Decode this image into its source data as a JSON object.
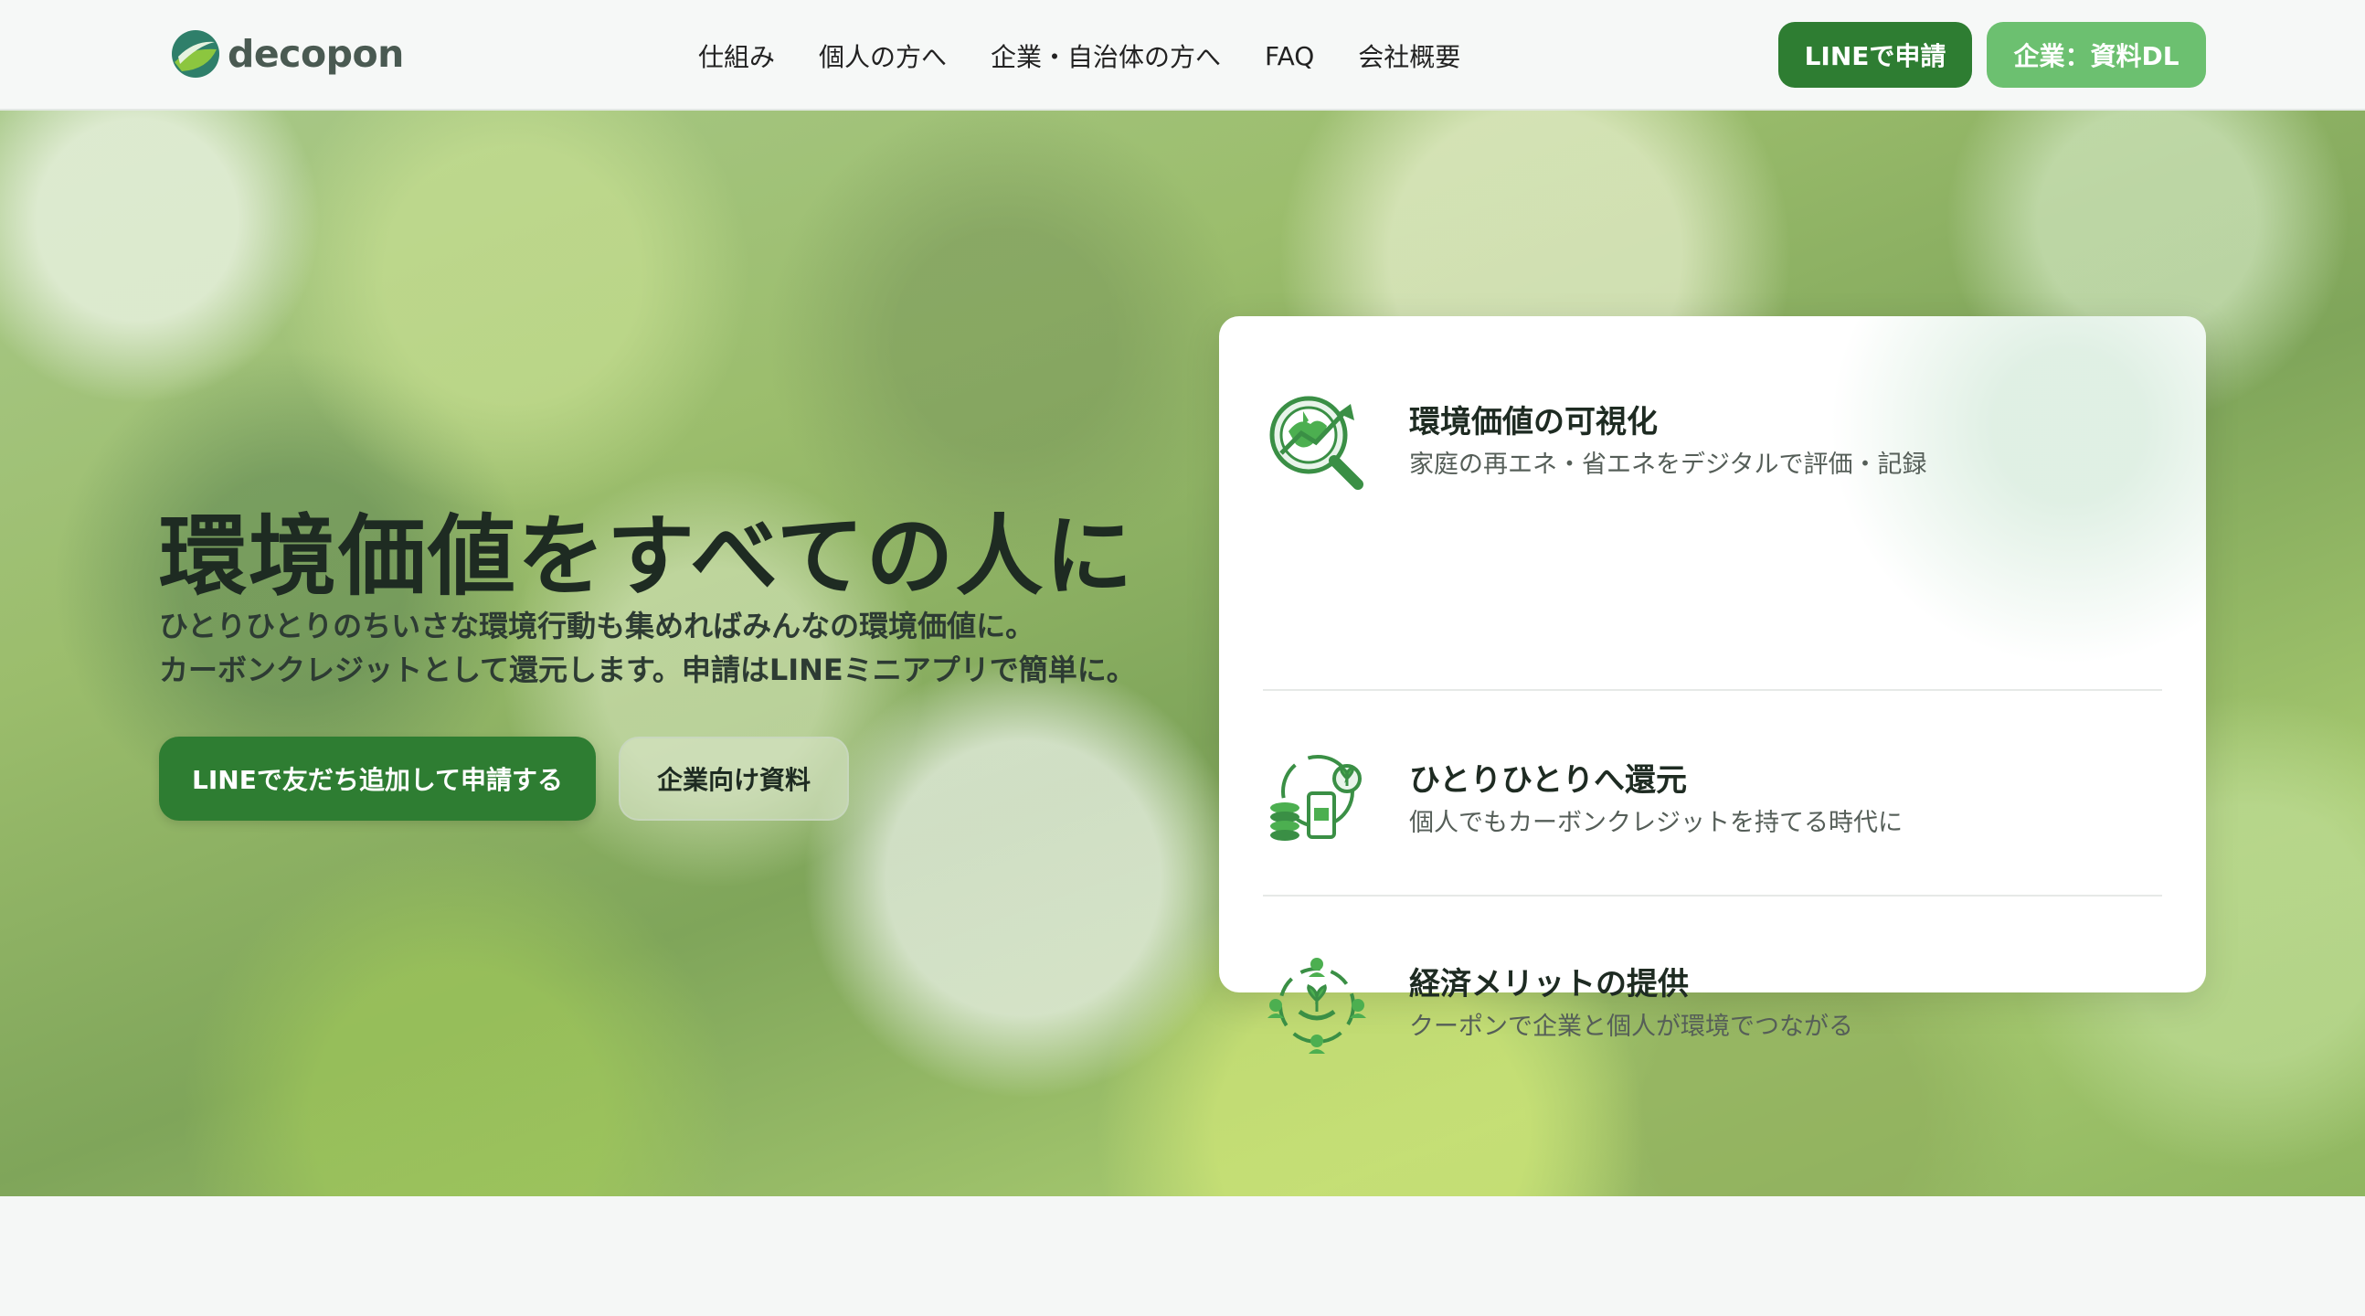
{
  "header": {
    "logo_text": "decopon",
    "nav": [
      "仕組み",
      "個人の方へ",
      "企業・自治体の方へ",
      "FAQ",
      "会社概要"
    ],
    "line_button": "LINEで申請",
    "dl_button": "企業：資料DL"
  },
  "hero": {
    "title": "環境価値をすべての人に",
    "subtitle_line1": "ひとりひとりのちいさな環境行動も集めればみんなの環境価値に。",
    "subtitle_line2": "カーボンクレジットとして還元します。申請はLINEミニアプリで簡単に。",
    "primary_button": "LINEで友だち追加して申請する",
    "secondary_button": "企業向け資料"
  },
  "features": [
    {
      "icon": "globe-magnifier-icon",
      "title": "環境価値の可視化",
      "desc": "家庭の再エネ・省エネをデジタルで評価・記録"
    },
    {
      "icon": "coins-phone-plant-icon",
      "title": "ひとりひとりへ還元",
      "desc": "個人でもカーボンクレジットを持てる時代に"
    },
    {
      "icon": "community-cycle-icon",
      "title": "経済メリットの提供",
      "desc": "クーポンで企業と個人が環境でつながる"
    }
  ],
  "colors": {
    "primary": "#2e7d32",
    "accent": "#6cc070",
    "background": "#f5f7f6"
  }
}
